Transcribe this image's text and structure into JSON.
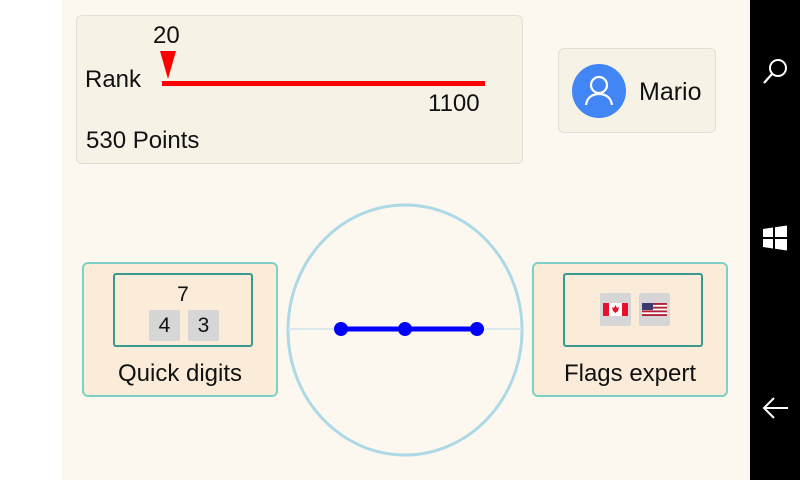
{
  "rank": {
    "label": "Rank",
    "current": "20",
    "max": "1100",
    "points": "530 Points"
  },
  "user": {
    "name": "Mario",
    "avatar_icon": "person-icon",
    "avatar_color": "#4285f4"
  },
  "games": [
    {
      "title": "Quick digits",
      "preview": {
        "top": "7",
        "left": "4",
        "right": "3"
      }
    },
    {
      "title": "Flags expert",
      "preview": {
        "flags": [
          "canada-flag-icon",
          "usa-flag-icon"
        ]
      }
    }
  ],
  "navbar": {
    "icons": [
      "search-icon",
      "windows-icon",
      "back-arrow-icon"
    ]
  },
  "colors": {
    "rank_bar": "#ff0000",
    "tile_border": "#7dd1c4",
    "tile_bg": "#faecd8",
    "graph_line": "#0000ff",
    "circle": "#add8e6"
  }
}
